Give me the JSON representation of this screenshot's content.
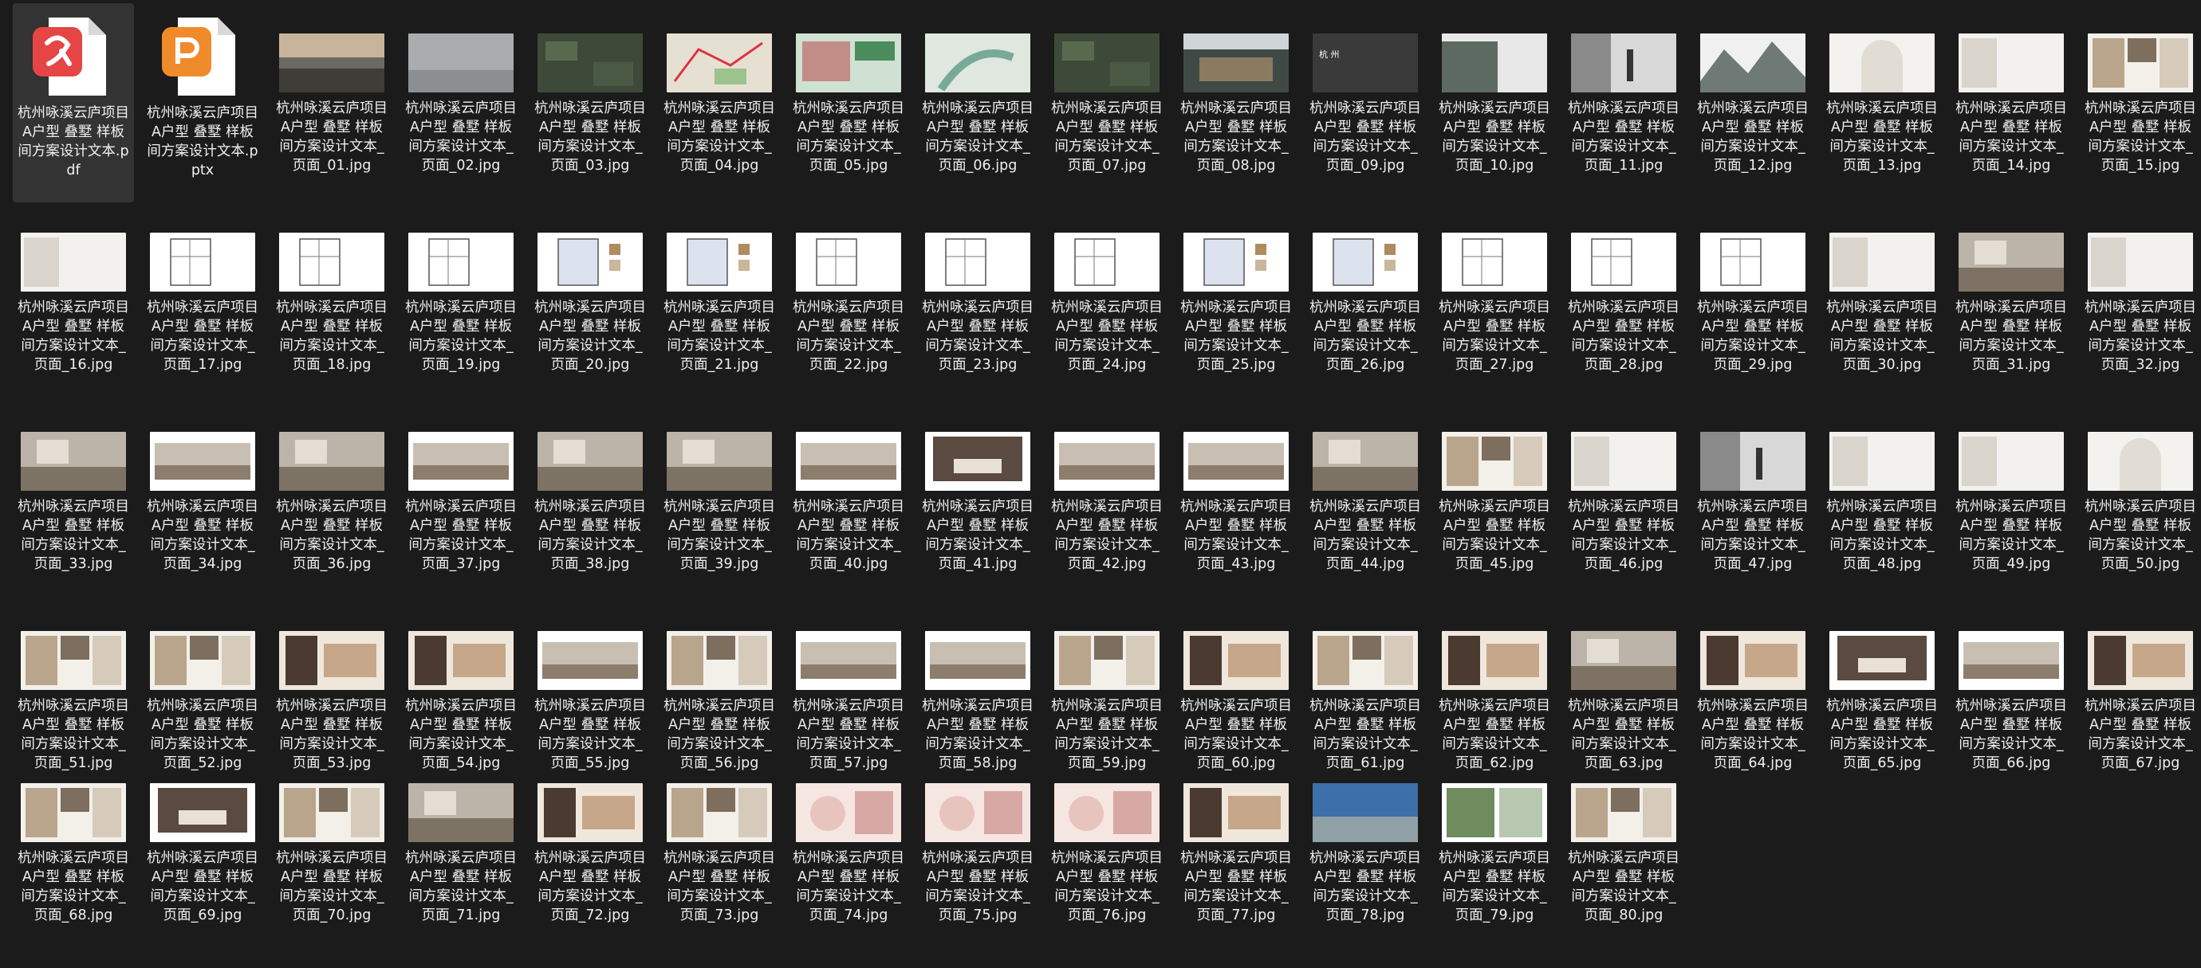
{
  "colors": {
    "background": "#1b1b1b",
    "selected": "#333333",
    "pdf_icon": "#e64545",
    "pptx_icon": "#f08b2c",
    "text": "#f0f0f0"
  },
  "files": [
    {
      "name": "杭州咏溪云庐项目A户型 叠墅 样板间方案设计文本.pdf",
      "kind": "pdf",
      "icon": "pdf-file-icon",
      "selected": true
    },
    {
      "name": "杭州咏溪云庐项目A户型 叠墅 样板间方案设计文本.pptx",
      "kind": "pptx",
      "icon": "pptx-file-icon"
    },
    {
      "name": "杭州咏溪云庐项目A户型 叠墅 样板间方案设计文本_页面_01.jpg",
      "kind": "jpg",
      "thumb": "landscape"
    },
    {
      "name": "杭州咏溪云庐项目A户型 叠墅 样板间方案设计文本_页面_02.jpg",
      "kind": "jpg",
      "thumb": "mist"
    },
    {
      "name": "杭州咏溪云庐项目A户型 叠墅 样板间方案设计文本_页面_03.jpg",
      "kind": "jpg",
      "thumb": "aerial"
    },
    {
      "name": "杭州咏溪云庐项目A户型 叠墅 样板间方案设计文本_页面_04.jpg",
      "kind": "jpg",
      "thumb": "map"
    },
    {
      "name": "杭州咏溪云庐项目A户型 叠墅 样板间方案设计文本_页面_05.jpg",
      "kind": "jpg",
      "thumb": "map2"
    },
    {
      "name": "杭州咏溪云庐项目A户型 叠墅 样板间方案设计文本_页面_06.jpg",
      "kind": "jpg",
      "thumb": "sitemap"
    },
    {
      "name": "杭州咏溪云庐项目A户型 叠墅 样板间方案设计文本_页面_07.jpg",
      "kind": "jpg",
      "thumb": "aerial"
    },
    {
      "name": "杭州咏溪云庐项目A户型 叠墅 样板间方案设计文本_页面_08.jpg",
      "kind": "jpg",
      "thumb": "building"
    },
    {
      "name": "杭州咏溪云庐项目A户型 叠墅 样板间方案设计文本_页面_09.jpg",
      "kind": "jpg",
      "thumb": "dark",
      "caption": "杭 州"
    },
    {
      "name": "杭州咏溪云庐项目A户型 叠墅 样板间方案设计文本_页面_10.jpg",
      "kind": "jpg",
      "thumb": "forest"
    },
    {
      "name": "杭州咏溪云庐项目A户型 叠墅 样板间方案设计文本_页面_11.jpg",
      "kind": "jpg",
      "thumb": "figure"
    },
    {
      "name": "杭州咏溪云庐项目A户型 叠墅 样板间方案设计文本_页面_12.jpg",
      "kind": "jpg",
      "thumb": "mountains"
    },
    {
      "name": "杭州咏溪云庐项目A户型 叠墅 样板间方案设计文本_页面_13.jpg",
      "kind": "jpg",
      "thumb": "arch"
    },
    {
      "name": "杭州咏溪云庐项目A户型 叠墅 样板间方案设计文本_页面_14.jpg",
      "kind": "jpg",
      "thumb": "light"
    },
    {
      "name": "杭州咏溪云庐项目A户型 叠墅 样板间方案设计文本_页面_15.jpg",
      "kind": "jpg",
      "thumb": "collage"
    },
    {
      "name": "杭州咏溪云庐项目A户型 叠墅 样板间方案设计文本_页面_16.jpg",
      "kind": "jpg",
      "thumb": "light"
    },
    {
      "name": "杭州咏溪云庐项目A户型 叠墅 样板间方案设计文本_页面_17.jpg",
      "kind": "jpg",
      "thumb": "plan"
    },
    {
      "name": "杭州咏溪云庐项目A户型 叠墅 样板间方案设计文本_页面_18.jpg",
      "kind": "jpg",
      "thumb": "plan"
    },
    {
      "name": "杭州咏溪云庐项目A户型 叠墅 样板间方案设计文本_页面_19.jpg",
      "kind": "jpg",
      "thumb": "plan"
    },
    {
      "name": "杭州咏溪云庐项目A户型 叠墅 样板间方案设计文本_页面_20.jpg",
      "kind": "jpg",
      "thumb": "plancolor"
    },
    {
      "name": "杭州咏溪云庐项目A户型 叠墅 样板间方案设计文本_页面_21.jpg",
      "kind": "jpg",
      "thumb": "plancolor"
    },
    {
      "name": "杭州咏溪云庐项目A户型 叠墅 样板间方案设计文本_页面_22.jpg",
      "kind": "jpg",
      "thumb": "plan"
    },
    {
      "name": "杭州咏溪云庐项目A户型 叠墅 样板间方案设计文本_页面_23.jpg",
      "kind": "jpg",
      "thumb": "plan"
    },
    {
      "name": "杭州咏溪云庐项目A户型 叠墅 样板间方案设计文本_页面_24.jpg",
      "kind": "jpg",
      "thumb": "plan"
    },
    {
      "name": "杭州咏溪云庐项目A户型 叠墅 样板间方案设计文本_页面_25.jpg",
      "kind": "jpg",
      "thumb": "plancolor"
    },
    {
      "name": "杭州咏溪云庐项目A户型 叠墅 样板间方案设计文本_页面_26.jpg",
      "kind": "jpg",
      "thumb": "plancolor"
    },
    {
      "name": "杭州咏溪云庐项目A户型 叠墅 样板间方案设计文本_页面_27.jpg",
      "kind": "jpg",
      "thumb": "plan"
    },
    {
      "name": "杭州咏溪云庐项目A户型 叠墅 样板间方案设计文本_页面_28.jpg",
      "kind": "jpg",
      "thumb": "plan"
    },
    {
      "name": "杭州咏溪云庐项目A户型 叠墅 样板间方案设计文本_页面_29.jpg",
      "kind": "jpg",
      "thumb": "plan"
    },
    {
      "name": "杭州咏溪云庐项目A户型 叠墅 样板间方案设计文本_页面_30.jpg",
      "kind": "jpg",
      "thumb": "light"
    },
    {
      "name": "杭州咏溪云庐项目A户型 叠墅 样板间方案设计文本_页面_31.jpg",
      "kind": "jpg",
      "thumb": "interior"
    },
    {
      "name": "杭州咏溪云庐项目A户型 叠墅 样板间方案设计文本_页面_32.jpg",
      "kind": "jpg",
      "thumb": "light"
    },
    {
      "name": "杭州咏溪云庐项目A户型 叠墅 样板间方案设计文本_页面_33.jpg",
      "kind": "jpg",
      "thumb": "interior"
    },
    {
      "name": "杭州咏溪云庐项目A户型 叠墅 样板间方案设计文本_页面_34.jpg",
      "kind": "jpg",
      "thumb": "interiorwhite"
    },
    {
      "name": "杭州咏溪云庐项目A户型 叠墅 样板间方案设计文本_页面_36.jpg",
      "kind": "jpg",
      "thumb": "interior"
    },
    {
      "name": "杭州咏溪云庐项目A户型 叠墅 样板间方案设计文本_页面_37.jpg",
      "kind": "jpg",
      "thumb": "interiorwhite"
    },
    {
      "name": "杭州咏溪云庐项目A户型 叠墅 样板间方案设计文本_页面_38.jpg",
      "kind": "jpg",
      "thumb": "interior"
    },
    {
      "name": "杭州咏溪云庐项目A户型 叠墅 样板间方案设计文本_页面_39.jpg",
      "kind": "jpg",
      "thumb": "interior"
    },
    {
      "name": "杭州咏溪云庐项目A户型 叠墅 样板间方案设计文本_页面_40.jpg",
      "kind": "jpg",
      "thumb": "interiorwhite"
    },
    {
      "name": "杭州咏溪云庐项目A户型 叠墅 样板间方案设计文本_页面_41.jpg",
      "kind": "jpg",
      "thumb": "bedroom"
    },
    {
      "name": "杭州咏溪云庐项目A户型 叠墅 样板间方案设计文本_页面_42.jpg",
      "kind": "jpg",
      "thumb": "interiorwhite"
    },
    {
      "name": "杭州咏溪云庐项目A户型 叠墅 样板间方案设计文本_页面_43.jpg",
      "kind": "jpg",
      "thumb": "interiorwhite"
    },
    {
      "name": "杭州咏溪云庐项目A户型 叠墅 样板间方案设计文本_页面_44.jpg",
      "kind": "jpg",
      "thumb": "interior"
    },
    {
      "name": "杭州咏溪云庐项目A户型 叠墅 样板间方案设计文本_页面_45.jpg",
      "kind": "jpg",
      "thumb": "collage"
    },
    {
      "name": "杭州咏溪云庐项目A户型 叠墅 样板间方案设计文本_页面_46.jpg",
      "kind": "jpg",
      "thumb": "light"
    },
    {
      "name": "杭州咏溪云庐项目A户型 叠墅 样板间方案设计文本_页面_47.jpg",
      "kind": "jpg",
      "thumb": "figure"
    },
    {
      "name": "杭州咏溪云庐项目A户型 叠墅 样板间方案设计文本_页面_48.jpg",
      "kind": "jpg",
      "thumb": "light"
    },
    {
      "name": "杭州咏溪云庐项目A户型 叠墅 样板间方案设计文本_页面_49.jpg",
      "kind": "jpg",
      "thumb": "light"
    },
    {
      "name": "杭州咏溪云庐项目A户型 叠墅 样板间方案设计文本_页面_50.jpg",
      "kind": "jpg",
      "thumb": "arch"
    },
    {
      "name": "杭州咏溪云庐项目A户型 叠墅 样板间方案设计文本_页面_51.jpg",
      "kind": "jpg",
      "thumb": "collage"
    },
    {
      "name": "杭州咏溪云庐项目A户型 叠墅 样板间方案设计文本_页面_52.jpg",
      "kind": "jpg",
      "thumb": "collage"
    },
    {
      "name": "杭州咏溪云庐项目A户型 叠墅 样板间方案设计文本_页面_53.jpg",
      "kind": "jpg",
      "thumb": "fashion"
    },
    {
      "name": "杭州咏溪云庐项目A户型 叠墅 样板间方案设计文本_页面_54.jpg",
      "kind": "jpg",
      "thumb": "fashion"
    },
    {
      "name": "杭州咏溪云庐项目A户型 叠墅 样板间方案设计文本_页面_55.jpg",
      "kind": "jpg",
      "thumb": "interiorwhite"
    },
    {
      "name": "杭州咏溪云庐项目A户型 叠墅 样板间方案设计文本_页面_56.jpg",
      "kind": "jpg",
      "thumb": "collage"
    },
    {
      "name": "杭州咏溪云庐项目A户型 叠墅 样板间方案设计文本_页面_57.jpg",
      "kind": "jpg",
      "thumb": "interiorwhite"
    },
    {
      "name": "杭州咏溪云庐项目A户型 叠墅 样板间方案设计文本_页面_58.jpg",
      "kind": "jpg",
      "thumb": "interiorwhite"
    },
    {
      "name": "杭州咏溪云庐项目A户型 叠墅 样板间方案设计文本_页面_59.jpg",
      "kind": "jpg",
      "thumb": "collage"
    },
    {
      "name": "杭州咏溪云庐项目A户型 叠墅 样板间方案设计文本_页面_60.jpg",
      "kind": "jpg",
      "thumb": "fashion"
    },
    {
      "name": "杭州咏溪云庐项目A户型 叠墅 样板间方案设计文本_页面_61.jpg",
      "kind": "jpg",
      "thumb": "collage"
    },
    {
      "name": "杭州咏溪云庐项目A户型 叠墅 样板间方案设计文本_页面_62.jpg",
      "kind": "jpg",
      "thumb": "fashion"
    },
    {
      "name": "杭州咏溪云庐项目A户型 叠墅 样板间方案设计文本_页面_63.jpg",
      "kind": "jpg",
      "thumb": "interior"
    },
    {
      "name": "杭州咏溪云庐项目A户型 叠墅 样板间方案设计文本_页面_64.jpg",
      "kind": "jpg",
      "thumb": "fashion"
    },
    {
      "name": "杭州咏溪云庐项目A户型 叠墅 样板间方案设计文本_页面_65.jpg",
      "kind": "jpg",
      "thumb": "bedroom"
    },
    {
      "name": "杭州咏溪云庐项目A户型 叠墅 样板间方案设计文本_页面_66.jpg",
      "kind": "jpg",
      "thumb": "interiorwhite"
    },
    {
      "name": "杭州咏溪云庐项目A户型 叠墅 样板间方案设计文本_页面_67.jpg",
      "kind": "jpg",
      "thumb": "fashion"
    },
    {
      "name": "杭州咏溪云庐项目A户型 叠墅 样板间方案设计文本_页面_68.jpg",
      "kind": "jpg",
      "thumb": "collage"
    },
    {
      "name": "杭州咏溪云庐项目A户型 叠墅 样板间方案设计文本_页面_69.jpg",
      "kind": "jpg",
      "thumb": "bedroom"
    },
    {
      "name": "杭州咏溪云庐项目A户型 叠墅 样板间方案设计文本_页面_70.jpg",
      "kind": "jpg",
      "thumb": "collage"
    },
    {
      "name": "杭州咏溪云庐项目A户型 叠墅 样板间方案设计文本_页面_71.jpg",
      "kind": "jpg",
      "thumb": "interior"
    },
    {
      "name": "杭州咏溪云庐项目A户型 叠墅 样板间方案设计文本_页面_72.jpg",
      "kind": "jpg",
      "thumb": "fashion"
    },
    {
      "name": "杭州咏溪云庐项目A户型 叠墅 样板间方案设计文本_页面_73.jpg",
      "kind": "jpg",
      "thumb": "collage"
    },
    {
      "name": "杭州咏溪云庐项目A户型 叠墅 样板间方案设计文本_页面_74.jpg",
      "kind": "jpg",
      "thumb": "pinkcollage"
    },
    {
      "name": "杭州咏溪云庐项目A户型 叠墅 样板间方案设计文本_页面_75.jpg",
      "kind": "jpg",
      "thumb": "pinkcollage"
    },
    {
      "name": "杭州咏溪云庐项目A户型 叠墅 样板间方案设计文本_页面_76.jpg",
      "kind": "jpg",
      "thumb": "pinkcollage"
    },
    {
      "name": "杭州咏溪云庐项目A户型 叠墅 样板间方案设计文本_页面_77.jpg",
      "kind": "jpg",
      "thumb": "fashion"
    },
    {
      "name": "杭州咏溪云庐项目A户型 叠墅 样板间方案设计文本_页面_78.jpg",
      "kind": "jpg",
      "thumb": "blue"
    },
    {
      "name": "杭州咏溪云庐项目A户型 叠墅 样板间方案设计文本_页面_79.jpg",
      "kind": "jpg",
      "thumb": "green"
    },
    {
      "name": "杭州咏溪云庐项目A户型 叠墅 样板间方案设计文本_页面_80.jpg",
      "kind": "jpg",
      "thumb": "collage"
    }
  ]
}
